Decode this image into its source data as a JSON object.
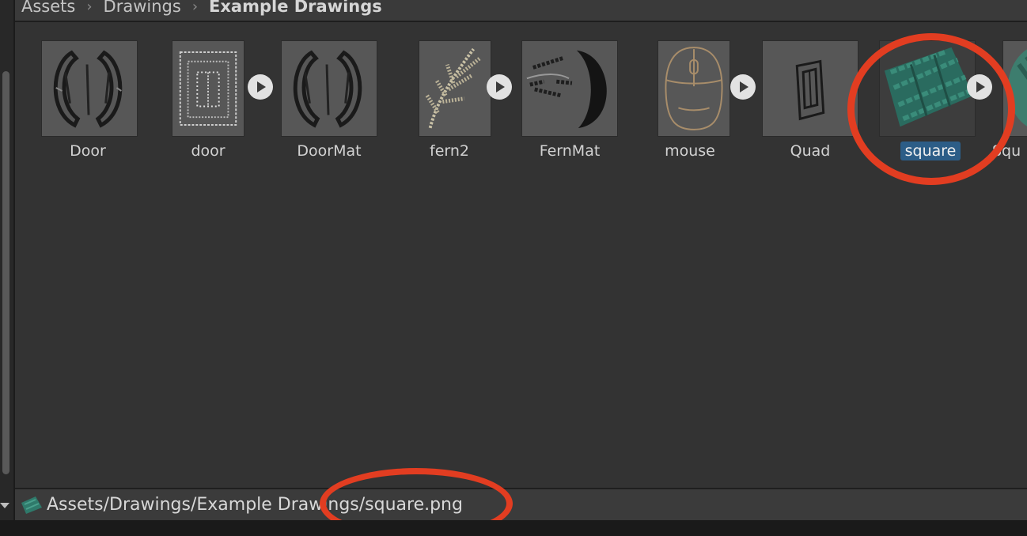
{
  "breadcrumb": {
    "items": [
      "Assets",
      "Drawings",
      "Example Drawings"
    ]
  },
  "assets": [
    {
      "name": "Door",
      "icon": "door-material-icon"
    },
    {
      "name": "door",
      "icon": "door-texture-icon"
    },
    {
      "name": "DoorMat",
      "icon": "door-material-icon"
    },
    {
      "name": "fern2",
      "icon": "fern-texture-icon"
    },
    {
      "name": "FernMat",
      "icon": "fern-material-icon"
    },
    {
      "name": "mouse",
      "icon": "mouse-texture-icon"
    },
    {
      "name": "Quad",
      "icon": "quad-mesh-icon"
    },
    {
      "name": "square",
      "icon": "square-texture-icon",
      "selected": true
    },
    {
      "name": "Squ",
      "icon": "square-material-icon"
    }
  ],
  "status": {
    "path": "Assets/Drawings/Example Drawings/square.png",
    "icon": "square-texture-icon"
  },
  "colors": {
    "selection": "#2c5d87",
    "highlight_ring": "#e23d21",
    "teal_drawing": "#2f7a6b"
  }
}
